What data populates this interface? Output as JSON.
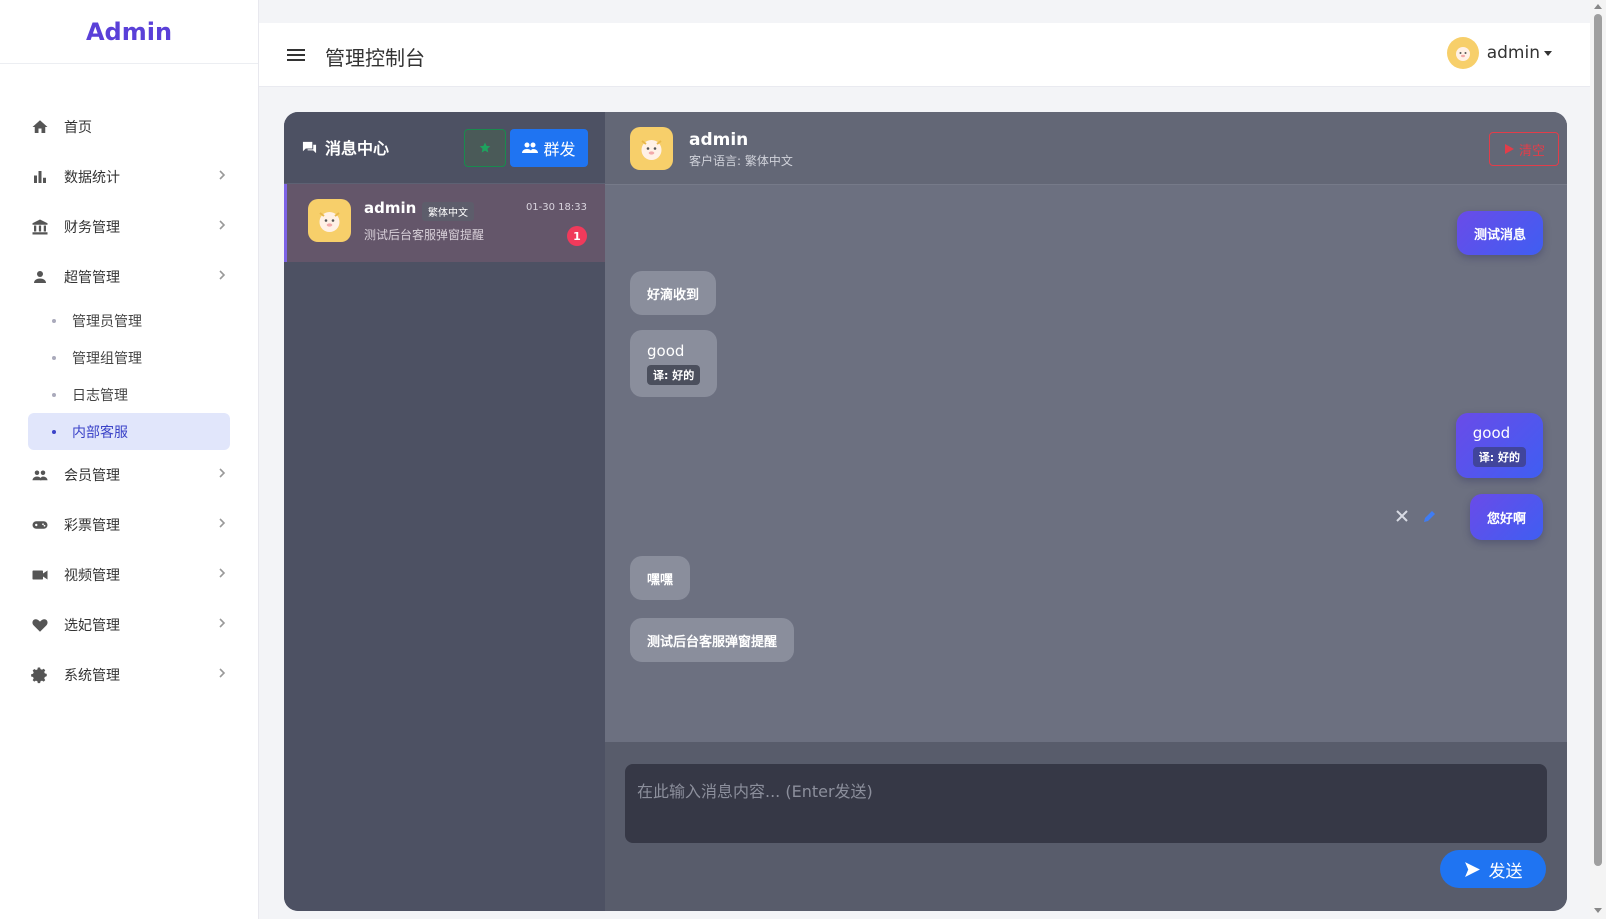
{
  "sidebar": {
    "brand": "Admin",
    "items": [
      {
        "label": "首页",
        "icon": "home-icon",
        "hasChildren": false
      },
      {
        "label": "数据统计",
        "icon": "bar-chart-icon",
        "hasChildren": true
      },
      {
        "label": "财务管理",
        "icon": "bank-icon",
        "hasChildren": true
      },
      {
        "label": "超管管理",
        "icon": "person-icon",
        "hasChildren": true
      },
      {
        "label": "会员管理",
        "icon": "group-icon",
        "hasChildren": true
      },
      {
        "label": "彩票管理",
        "icon": "gamepad-icon",
        "hasChildren": true
      },
      {
        "label": "视频管理",
        "icon": "video-camera-icon",
        "hasChildren": true
      },
      {
        "label": "选妃管理",
        "icon": "heart-icon",
        "hasChildren": true
      },
      {
        "label": "系统管理",
        "icon": "gear-icon",
        "hasChildren": true
      }
    ],
    "subitems": [
      {
        "label": "管理员管理",
        "active": false
      },
      {
        "label": "管理组管理",
        "active": false
      },
      {
        "label": "日志管理",
        "active": false
      },
      {
        "label": "内部客服",
        "active": true
      }
    ]
  },
  "header": {
    "title": "管理控制台",
    "user": "admin"
  },
  "chat": {
    "list_title": "消息中心",
    "group_label": "群发",
    "conversation": {
      "name": "admin",
      "tag": "繁体中文",
      "time": "01-30 18:33",
      "preview": "测试后台客服弹窗提醒",
      "unread": "1"
    },
    "active": {
      "name": "admin",
      "lang": "客户语言: 繁体中文",
      "danger_label": "清空"
    },
    "messages": {
      "m1": {
        "text": "测试消息",
        "dir": "out"
      },
      "m2": {
        "text": "好滴收到",
        "dir": "in"
      },
      "m3": {
        "text": "good",
        "translation": "译: 好的",
        "dir": "in"
      },
      "m4": {
        "text": "good",
        "translation": "译: 好的",
        "dir": "out"
      },
      "m5": {
        "text": "您好啊",
        "dir": "out"
      },
      "m6": {
        "text": "嘿嘿",
        "dir": "in"
      },
      "m7": {
        "text": "测试后台客服弹窗提醒",
        "dir": "in"
      }
    },
    "input_placeholder": "在此输入消息内容... (Enter发送)",
    "send_label": "发送"
  },
  "colors": {
    "brand": "#5a40d8",
    "primary": "#1f74f2",
    "danger": "#e23d4a",
    "unread": "#f03a5b"
  }
}
